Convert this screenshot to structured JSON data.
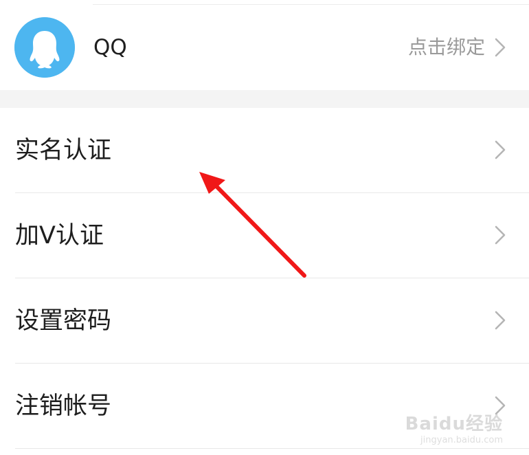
{
  "qq_binding": {
    "label": "QQ",
    "action_label": "点击绑定",
    "avatar_color": "#4db6f0"
  },
  "menu": {
    "items": [
      {
        "label": "实名认证"
      },
      {
        "label": "加V认证"
      },
      {
        "label": "设置密码"
      },
      {
        "label": "注销帐号"
      }
    ]
  },
  "annotation": {
    "arrow_color": "#f01818"
  },
  "watermark": {
    "logo": "Baidu经验",
    "url": "jingyan.baidu.com"
  }
}
